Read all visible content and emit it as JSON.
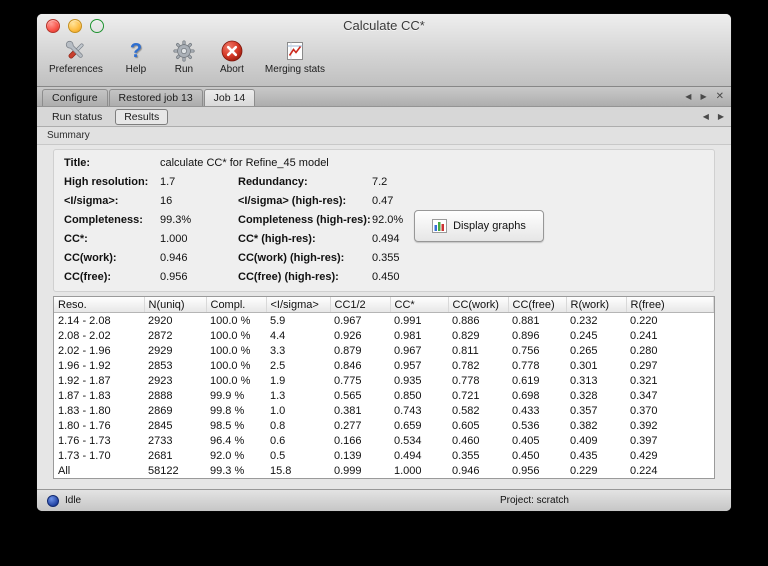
{
  "window": {
    "title": "Calculate CC*"
  },
  "colors": {
    "abort_red": "#d0392b",
    "help_blue": "#2e6ed0",
    "status_dot_blue": "#1c3d9e"
  },
  "toolbar": {
    "items": [
      {
        "label": "Preferences",
        "icon": "preferences-tools-icon"
      },
      {
        "label": "Help",
        "icon": "help-question-icon"
      },
      {
        "label": "Run",
        "icon": "run-gear-icon"
      },
      {
        "label": "Abort",
        "icon": "abort-cross-icon"
      },
      {
        "label": "Merging stats",
        "icon": "merging-stats-chart-icon"
      }
    ]
  },
  "tabs": {
    "row1": [
      {
        "label": "Configure",
        "active": false
      },
      {
        "label": "Restored job 13",
        "active": false
      },
      {
        "label": "Job 14",
        "active": true
      }
    ],
    "row1_nav": {
      "prev": "◀",
      "next": "▶",
      "close": "✕"
    },
    "row2": [
      {
        "label": "Run status",
        "active": false
      },
      {
        "label": "Results",
        "active": true
      }
    ],
    "row2_nav": {
      "prev": "◀",
      "next": "▶"
    }
  },
  "section": {
    "label": "Summary"
  },
  "summary": {
    "title_label": "Title:",
    "title_value": "calculate CC* for Refine_45 model",
    "rows": [
      {
        "l1": "High resolution:",
        "v1": "1.7",
        "l2": "Redundancy:",
        "v2": "7.2"
      },
      {
        "l1": "<I/sigma>:",
        "v1": "16",
        "l2": "<I/sigma> (high-res):",
        "v2": "0.47"
      },
      {
        "l1": "Completeness:",
        "v1": "99.3%",
        "l2": "Completeness (high-res):",
        "v2": "92.0%"
      },
      {
        "l1": "CC*:",
        "v1": "1.000",
        "l2": "CC* (high-res):",
        "v2": "0.494"
      },
      {
        "l1": "CC(work):",
        "v1": "0.946",
        "l2": "CC(work) (high-res):",
        "v2": "0.355"
      },
      {
        "l1": "CC(free):",
        "v1": "0.956",
        "l2": "CC(free) (high-res):",
        "v2": "0.450"
      }
    ],
    "display_graphs_label": "Display graphs"
  },
  "table": {
    "columns": [
      "Reso.",
      "N(uniq)",
      "Compl.",
      "<I/sigma>",
      "CC1/2",
      "CC*",
      "CC(work)",
      "CC(free)",
      "R(work)",
      "R(free)"
    ],
    "rows": [
      [
        "2.14 - 2.08",
        "2920",
        "100.0 %",
        "5.9",
        "0.967",
        "0.991",
        "0.886",
        "0.881",
        "0.232",
        "0.220"
      ],
      [
        "2.08 - 2.02",
        "2872",
        "100.0 %",
        "4.4",
        "0.926",
        "0.981",
        "0.829",
        "0.896",
        "0.245",
        "0.241"
      ],
      [
        "2.02 - 1.96",
        "2929",
        "100.0 %",
        "3.3",
        "0.879",
        "0.967",
        "0.811",
        "0.756",
        "0.265",
        "0.280"
      ],
      [
        "1.96 - 1.92",
        "2853",
        "100.0 %",
        "2.5",
        "0.846",
        "0.957",
        "0.782",
        "0.778",
        "0.301",
        "0.297"
      ],
      [
        "1.92 - 1.87",
        "2923",
        "100.0 %",
        "1.9",
        "0.775",
        "0.935",
        "0.778",
        "0.619",
        "0.313",
        "0.321"
      ],
      [
        "1.87 - 1.83",
        "2888",
        "99.9 %",
        "1.3",
        "0.565",
        "0.850",
        "0.721",
        "0.698",
        "0.328",
        "0.347"
      ],
      [
        "1.83 - 1.80",
        "2869",
        "99.8 %",
        "1.0",
        "0.381",
        "0.743",
        "0.582",
        "0.433",
        "0.357",
        "0.370"
      ],
      [
        "1.80 - 1.76",
        "2845",
        "98.5 %",
        "0.8",
        "0.277",
        "0.659",
        "0.605",
        "0.536",
        "0.382",
        "0.392"
      ],
      [
        "1.76 - 1.73",
        "2733",
        "96.4 %",
        "0.6",
        "0.166",
        "0.534",
        "0.460",
        "0.405",
        "0.409",
        "0.397"
      ],
      [
        "1.73 - 1.70",
        "2681",
        "92.0 %",
        "0.5",
        "0.139",
        "0.494",
        "0.355",
        "0.450",
        "0.435",
        "0.429"
      ],
      [
        "All",
        "58122",
        "99.3 %",
        "15.8",
        "0.999",
        "1.000",
        "0.946",
        "0.956",
        "0.229",
        "0.224"
      ]
    ]
  },
  "statusbar": {
    "status": "Idle",
    "project": "Project: scratch"
  }
}
